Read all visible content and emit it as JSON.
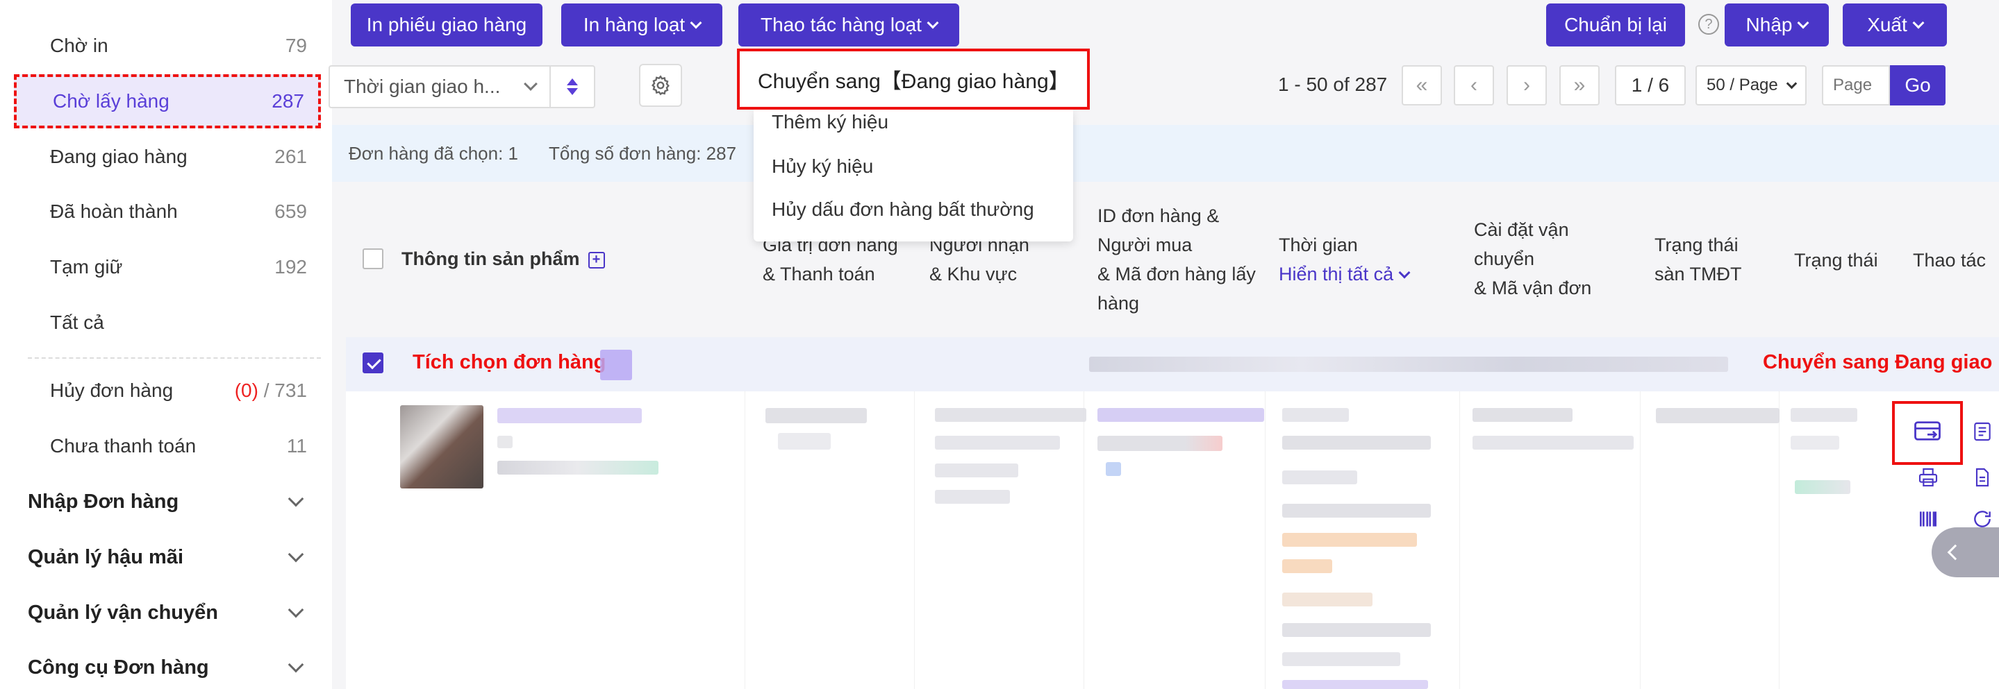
{
  "sidebar": {
    "items": [
      {
        "label": "Chờ in",
        "count": "79"
      },
      {
        "label": "Chờ lấy hàng",
        "count": "287"
      },
      {
        "label": "Đang giao hàng",
        "count": "261"
      },
      {
        "label": "Đã hoàn thành",
        "count": "659"
      },
      {
        "label": "Tạm giữ",
        "count": "192"
      },
      {
        "label": "Tất cả",
        "count": ""
      }
    ],
    "cancel": {
      "label": "Hủy đơn hàng",
      "count_red": "(0)",
      "count_rest": "/ 731"
    },
    "unpaid": {
      "label": "Chưa thanh toán",
      "count": "11"
    },
    "groups": [
      {
        "label": "Nhập Đơn hàng"
      },
      {
        "label": "Quản lý hậu mãi"
      },
      {
        "label": "Quản lý vận chuyển"
      },
      {
        "label": "Công cụ Đơn hàng"
      }
    ]
  },
  "toolbar": {
    "print_delivery": "In phiếu giao hàng",
    "print_batch": "In hàng loạt",
    "batch_ops": "Thao tác hàng loạt",
    "prepare_again": "Chuẩn bị lại",
    "import": "Nhập",
    "export": "Xuất",
    "help_glyph": "?"
  },
  "filter": {
    "date_select": "Thời gian giao h..."
  },
  "pagination": {
    "range": "1 - 50 of 287",
    "first": "«",
    "prev": "‹",
    "next": "›",
    "last": "»",
    "page_indicator": "1 / 6",
    "per_page": "50 / Page",
    "page_placeholder": "Page",
    "go": "Go"
  },
  "info_bar": {
    "selected": "Đơn hàng đã chọn: 1",
    "total": "Tổng số đơn hàng: 287"
  },
  "table_header": {
    "product_info": "Thông tin sản phẩm",
    "plus": "+",
    "order_value_l1": "Giá trị đơn hàng",
    "order_value_l2": "& Thanh toán",
    "recipient_l1": "Người nhận",
    "recipient_l2": "& Khu vực",
    "order_id_l1": "ID đơn hàng &",
    "order_id_l2": "Người mua",
    "order_id_l3": "& Mã đơn hàng lấy",
    "order_id_l4": "hàng",
    "time_l1": "Thời gian",
    "time_l2": "Hiển thị tất cả",
    "shipping_l1": "Cài đặt vận",
    "shipping_l2": "chuyển",
    "shipping_l3": "& Mã vận đơn",
    "platform_l1": "Trạng thái",
    "platform_l2": "sàn TMĐT",
    "status": "Trạng thái",
    "actions": "Thao tác"
  },
  "order": {
    "select_label": "Tích chọn đơn hàng",
    "action_label": "Chuyển sang Đang giao hàng"
  },
  "dropdown": {
    "highlight": "Chuyển sang【Đang giao hàng】",
    "items": [
      "Thêm ký hiệu",
      "Hủy ký hiệu",
      "Hủy dấu đơn hàng bất thường"
    ]
  },
  "colors": {
    "primary": "#4a36c8",
    "annotation_red": "#e11111",
    "active_bg": "#ece8fb",
    "info_bg": "#ebf3fc"
  }
}
